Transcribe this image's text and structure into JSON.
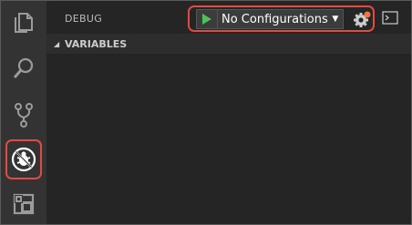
{
  "panel": {
    "title": "DEBUG",
    "configuration": "No Configurations",
    "section": "VARIABLES"
  },
  "activity_bar": {
    "icons": [
      "files-icon",
      "search-icon",
      "source-control-icon",
      "debug-icon",
      "extensions-icon"
    ],
    "active": "debug-icon"
  },
  "colors": {
    "accent_green": "#4fc15a",
    "highlight_red": "#e14b43",
    "badge_orange": "#f3743d"
  }
}
